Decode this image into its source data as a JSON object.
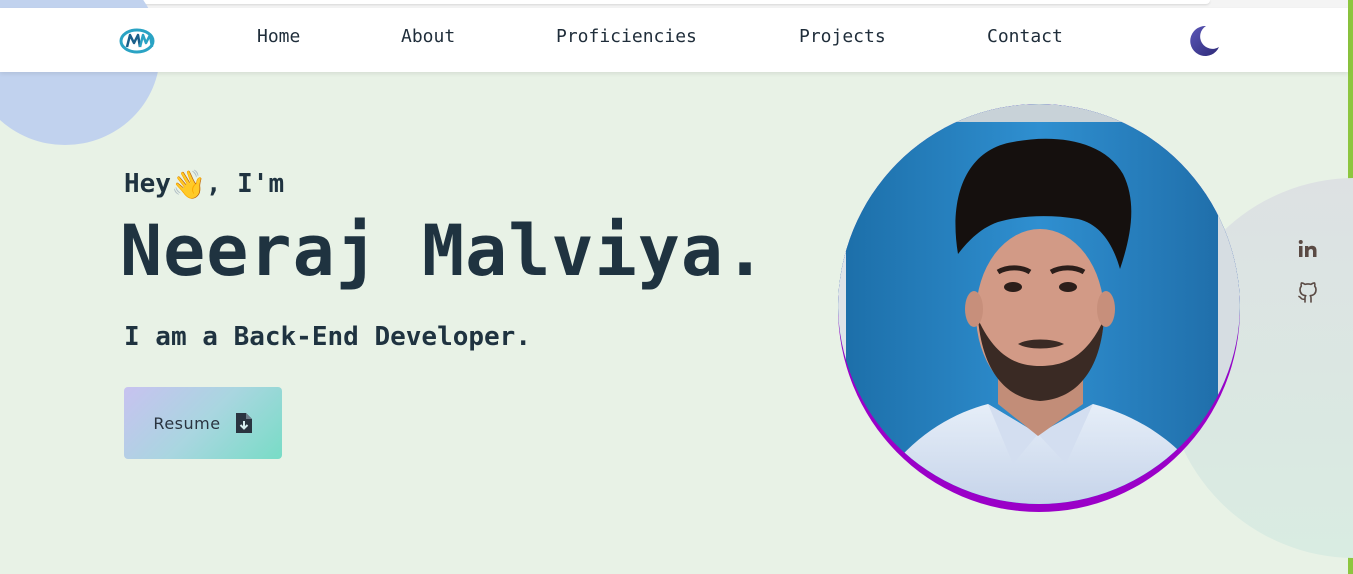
{
  "nav": {
    "logo_text": "NM",
    "links": [
      {
        "label": "Home"
      },
      {
        "label": "About"
      },
      {
        "label": "Proficiencies"
      },
      {
        "label": "Projects"
      },
      {
        "label": "Contact"
      }
    ],
    "theme_icon": "moon-icon"
  },
  "hero": {
    "greeting_prefix": "Hey",
    "greeting_emoji": "👋",
    "greeting_suffix": ", I'm",
    "name": "Neeraj Malviya.",
    "subtitle": "I am a Back-End Developer.",
    "resume_label": "Resume",
    "resume_icon": "file-download-icon"
  },
  "photo": {
    "subject": "profile-photo",
    "ring_color": "#9b00c8"
  },
  "social": [
    {
      "icon": "linkedin-icon"
    },
    {
      "icon": "github-icon"
    }
  ],
  "colors": {
    "background": "#e8f2e6",
    "text": "#1f3340",
    "accent_ring": "#9b00c8",
    "edge": "#8dc63f"
  }
}
